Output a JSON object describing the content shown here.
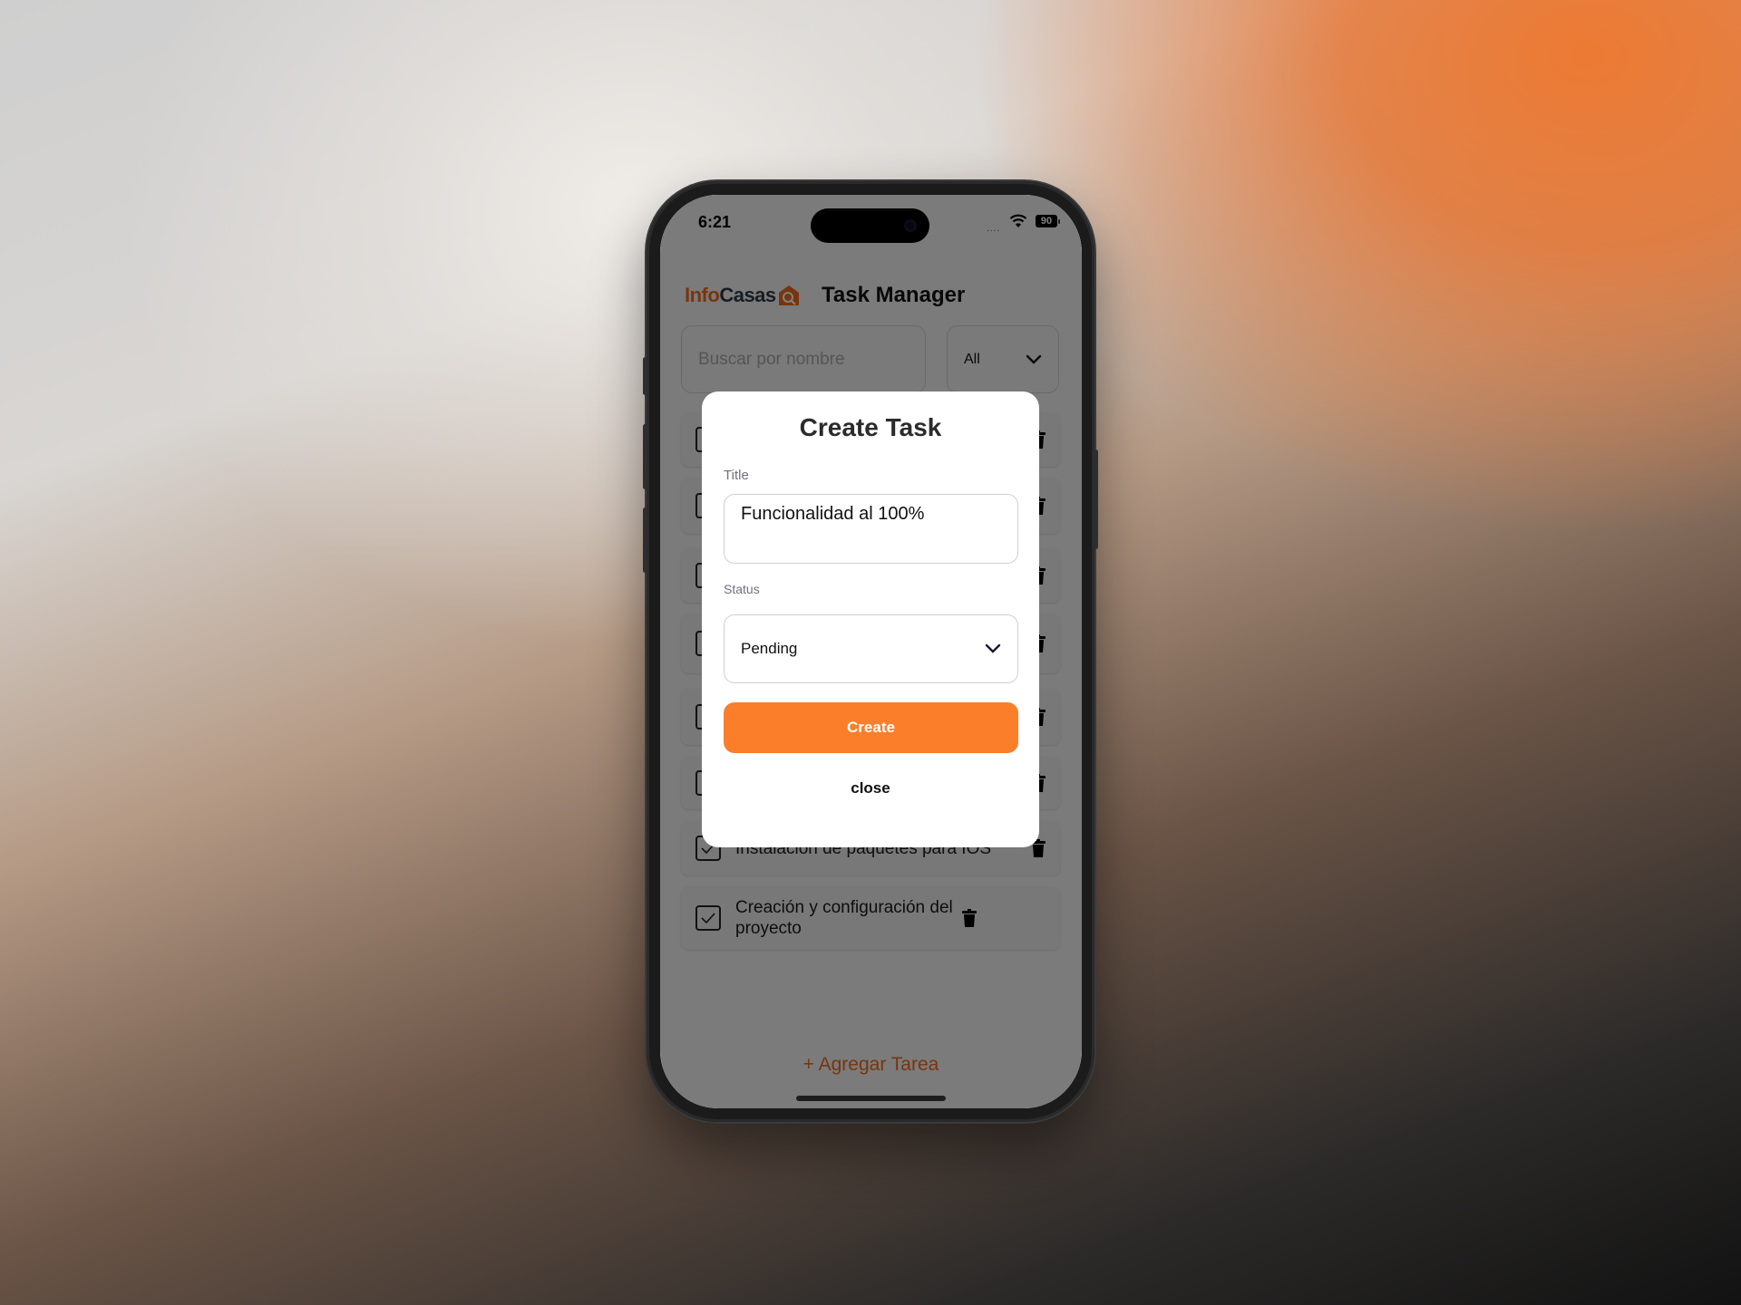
{
  "status_bar": {
    "time": "6:21",
    "signal": "....",
    "battery": "90"
  },
  "header": {
    "logo_part1": "Info",
    "logo_part2": "Casas",
    "title": "Task Manager"
  },
  "filters": {
    "search_placeholder": "Buscar por nombre",
    "status_filter_value": "All"
  },
  "tasks": [
    {
      "title": "",
      "done": false
    },
    {
      "title": "",
      "done": false
    },
    {
      "title": "",
      "done": false
    },
    {
      "title": "",
      "done": false
    },
    {
      "title": "",
      "done": false
    },
    {
      "title": "",
      "done": false
    },
    {
      "title": "Instalación de paquetes para IOS",
      "done": true
    },
    {
      "title": "Creación y configuración del proyecto",
      "done": true
    }
  ],
  "add_task_label": "+ Agregar Tarea",
  "modal": {
    "heading": "Create Task",
    "title_label": "Title",
    "title_value": "Funcionalidad al 100%",
    "status_label": "Status",
    "status_value": "Pending",
    "create_label": "Create",
    "close_label": "close"
  },
  "colors": {
    "brand_orange": "#ee6b1f",
    "button_orange": "#fb7e2a",
    "logo_dark": "#2d3a44"
  }
}
